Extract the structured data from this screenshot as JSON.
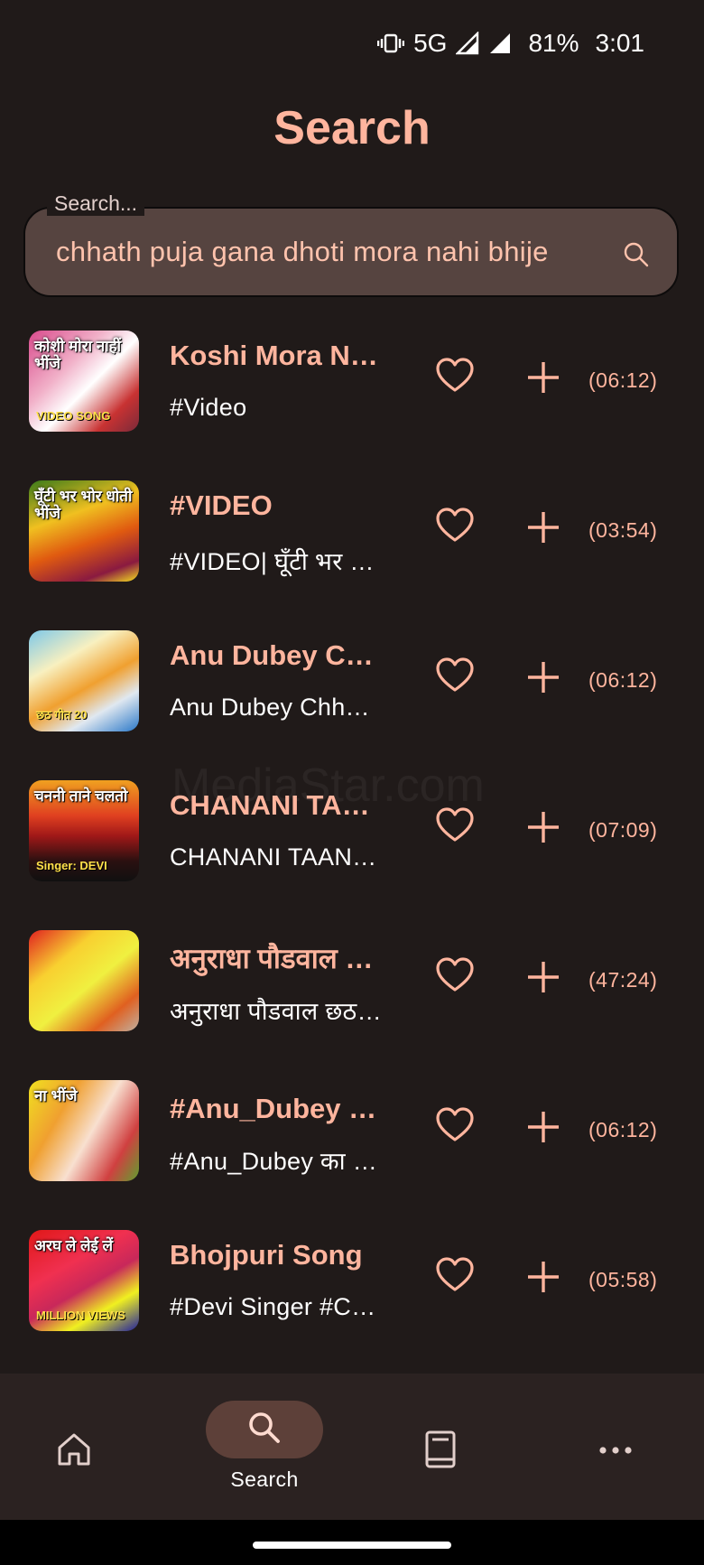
{
  "status_bar": {
    "network": "5G",
    "battery": "81%",
    "time": "3:01"
  },
  "page_title": "Search",
  "search": {
    "label": "Search...",
    "value": "chhath puja gana dhoti mora nahi bhije"
  },
  "watermark": "MediaStar.com",
  "thumb_texts": [
    {
      "a": "कोशी मोरा नाहीं भींजे",
      "b": "VIDEO SONG"
    },
    {
      "a": "घूँटी भर भोर धोती भींजे",
      "b": ""
    },
    {
      "a": "",
      "b": "छठ गीत 20"
    },
    {
      "a": "चननी ताने चलतो",
      "b": "Singer: DEVI"
    },
    {
      "a": "",
      "b": ""
    },
    {
      "a": "ना भींजे",
      "b": ""
    },
    {
      "a": "अरघ ले लेई लें",
      "b": "MILLION VIEWS"
    }
  ],
  "results": [
    {
      "title": "Koshi Mora Nahi Bhije",
      "subtitle": "#Video",
      "duration": "(06:12)"
    },
    {
      "title": "#VIDEO",
      "subtitle": "#VIDEO| घूँटी भर भोर धोती भींजे",
      "duration": "(03:54)"
    },
    {
      "title": "Anu Dubey Chhath Geet",
      "subtitle": "Anu Dubey Chhath Geet",
      "duration": "(06:12)"
    },
    {
      "title": "CHANANI TAANE CHALATO",
      "subtitle": "CHANANI TAANE CHALATO",
      "duration": "(07:09)"
    },
    {
      "title": "अनुराधा पौडवाल छठ गीत",
      "subtitle": "अनुराधा पौडवाल छठ गीत",
      "duration": "(47:24)"
    },
    {
      "title": "#Anu_Dubey का छठ गीत",
      "subtitle": "#Anu_Dubey का छठ गीत",
      "duration": "(06:12)"
    },
    {
      "title": "Bhojpuri Song",
      "subtitle": "#Devi Singer #Chhath",
      "duration": "(05:58)"
    }
  ],
  "bottom_nav": {
    "search_label": "Search"
  },
  "colors": {
    "background": "#201a19",
    "accent": "#ffb59e",
    "search_fill": "#564440",
    "nav_pill": "#5d4039"
  }
}
